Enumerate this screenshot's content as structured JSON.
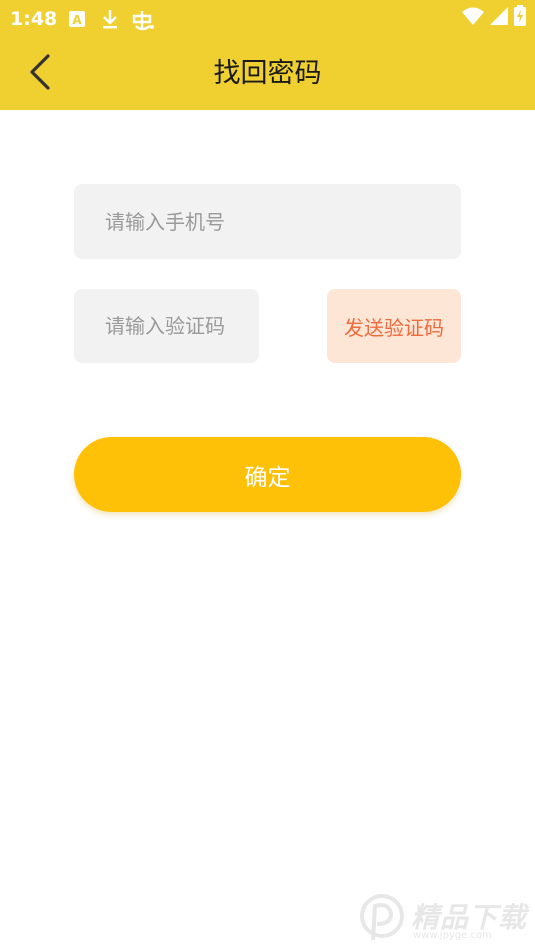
{
  "status_bar": {
    "time": "1:48",
    "icons": [
      "a-app-icon",
      "download-icon",
      "bug-app-icon"
    ],
    "right_icons": [
      "wifi-icon",
      "signal-icon",
      "battery-charging-icon"
    ]
  },
  "nav": {
    "title": "找回密码",
    "back_icon": "chevron-left-icon"
  },
  "form": {
    "phone_placeholder": "请输入手机号",
    "phone_value": "",
    "code_placeholder": "请输入验证码",
    "code_value": "",
    "send_code_label": "发送验证码",
    "confirm_label": "确定"
  },
  "watermark": {
    "brand": "精品下载",
    "url": "www.jpyge.com"
  },
  "colors": {
    "header": "#EFD030",
    "input_bg": "#F2F2F2",
    "send_code_bg": "#FDE6D6",
    "send_code_text": "#EE6B3D",
    "confirm_bg": "#FFC107"
  }
}
